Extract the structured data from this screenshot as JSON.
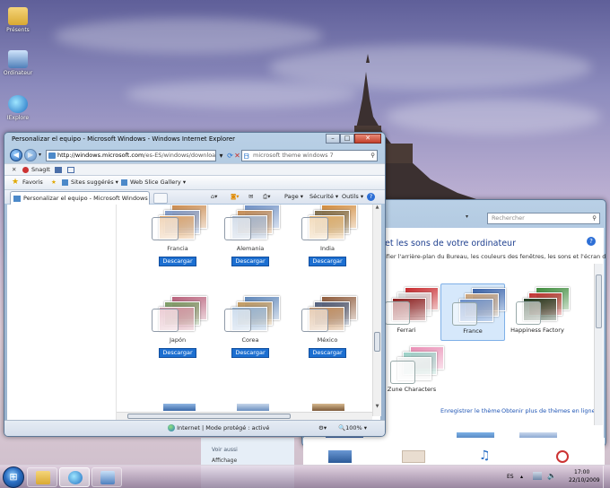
{
  "desktop": {
    "icons": [
      {
        "label": "Présents",
        "icon": "folder-icon"
      },
      {
        "label": "Ordinateur",
        "icon": "computer-icon"
      },
      {
        "label": "IExplore",
        "icon": "internet-explorer-icon"
      }
    ]
  },
  "ie_window": {
    "title": "Personalizar el equipo - Microsoft Windows - Windows Internet Explorer",
    "address_domain": "http://windows.microsoft.com",
    "address_path": "/es-ES/windows/downloa",
    "search_value": "microsoft theme windows 7",
    "linkbar": {
      "snagit_label": "SnagIt"
    },
    "favorites": {
      "favorites_label": "Favoris",
      "suggested_label": "Sites suggérés ▾",
      "webslice_label": "Web Slice Gallery ▾"
    },
    "tab_title": "Personalizar el equipo - Microsoft Windows",
    "commands": {
      "page": "Page ▾",
      "security": "Sécurité ▾",
      "tools": "Outils ▾",
      "help": "?"
    },
    "download_label": "Descargar",
    "themes": [
      {
        "name": "Francia",
        "colors": [
          "#c98a4e",
          "#7f9ac9",
          "#e0a364"
        ]
      },
      {
        "name": "Alemania",
        "colors": [
          "#6d8fc4",
          "#c58c55",
          "#9eb3cf"
        ]
      },
      {
        "name": "India",
        "colors": [
          "#d08a3c",
          "#7f6d4a",
          "#e3b06a"
        ]
      },
      {
        "name": "Japón",
        "colors": [
          "#b8607a",
          "#7a9a62",
          "#d48fa0"
        ]
      },
      {
        "name": "Corea",
        "colors": [
          "#5e86b9",
          "#c0995f",
          "#8fb1d6"
        ]
      },
      {
        "name": "México",
        "colors": [
          "#8e5a3a",
          "#4f5d7a",
          "#c98e58"
        ]
      }
    ],
    "status_text": "Internet | Mode protégé : activé",
    "zoom": "100%"
  },
  "back_window": {
    "search_placeholder": "Rechercher",
    "heading": "et les sons de votre ordinateur",
    "subheading": "ifier l'arrière-plan du Bureau, les couleurs des fenêtres, les sons et l'écran de veille en",
    "themes": [
      {
        "name": "Ferrari",
        "colors": [
          "#c7272b",
          "#d8d8d8",
          "#8a1c1c"
        ]
      },
      {
        "name": "France",
        "colors": [
          "#3a62a8",
          "#c9a27a",
          "#6b8fc9"
        ]
      },
      {
        "name": "Happiness Factory",
        "colors": [
          "#3c8a3a",
          "#c12f2f",
          "#1f3a1f"
        ]
      },
      {
        "name": "Zune Characters",
        "colors": [
          "#e98fb5",
          "#9ad0c6",
          "#f2f2f2"
        ]
      }
    ],
    "save_theme_link": "Enregistrer le thème",
    "more_themes_link": "Obtenir plus de thèmes en ligne",
    "leftpane": {
      "see_also": "Voir aussi",
      "display": "Affichage"
    }
  },
  "taskbar": {
    "language": "ES",
    "time": "17:00",
    "date": "22/10/2009"
  }
}
